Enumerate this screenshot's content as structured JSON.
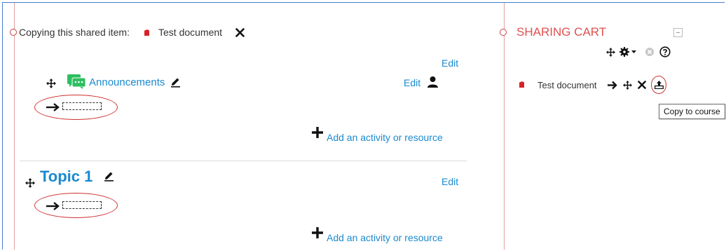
{
  "copy_bar": {
    "prefix": "Copying this shared item:",
    "item_name": "Test document"
  },
  "announcements_section": {
    "edit_label": "Edit",
    "forum_name": "Announcements",
    "activity_edit_label": "Edit",
    "add_label": "Add an activity or resource"
  },
  "topic_section": {
    "title": "Topic 1",
    "edit_label": "Edit",
    "add_label": "Add an activity or resource"
  },
  "sharing_cart": {
    "title": "SHARING CART",
    "item_name": "Test document",
    "tooltip": "Copy to course"
  },
  "colors": {
    "accent_blue": "#1a8ad0",
    "cart_title_red": "#e05050",
    "highlight_red": "#d03030",
    "forum_green": "#2dbe60"
  }
}
